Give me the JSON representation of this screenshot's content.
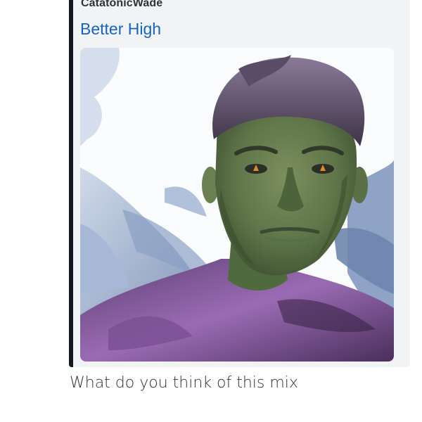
{
  "embed": {
    "author": "CatatonicWade",
    "title": "Better High",
    "border_color": "#131722",
    "title_color": "#1565c0"
  },
  "message": {
    "text": "What do you think of this mix"
  }
}
